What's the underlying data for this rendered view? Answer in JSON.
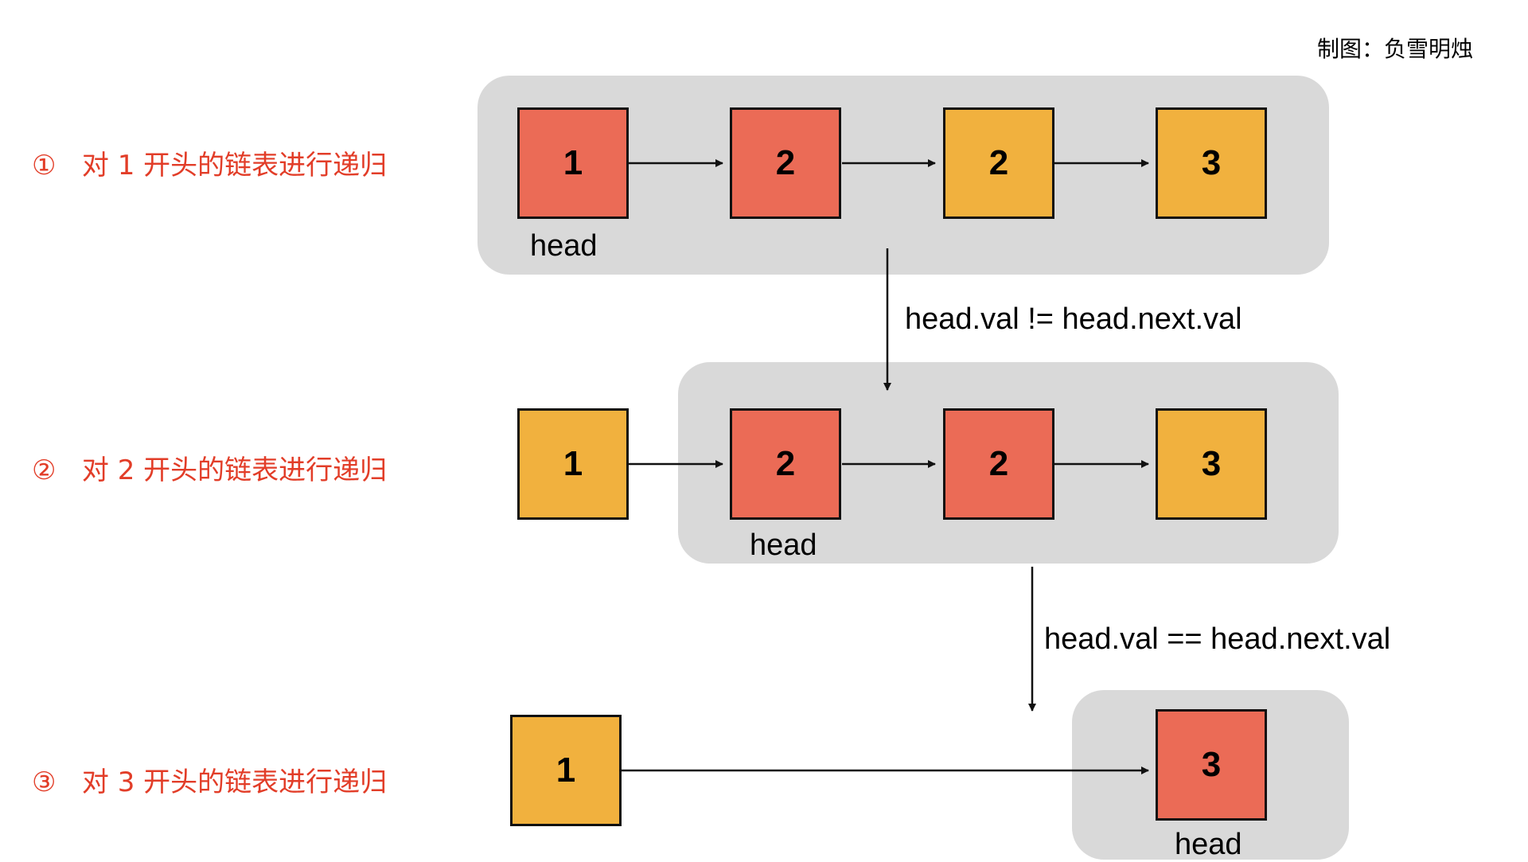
{
  "credit": "制图：负雪明烛",
  "steps": [
    {
      "marker": "①",
      "text": "对 1 开头的链表进行递归"
    },
    {
      "marker": "②",
      "text": "对 2 开头的链表进行递归"
    },
    {
      "marker": "③",
      "text": "对 3 开头的链表进行递归"
    }
  ],
  "rows": [
    {
      "nodes": [
        "1",
        "2",
        "2",
        "3"
      ],
      "head_label": "head"
    },
    {
      "nodes": [
        "1",
        "2",
        "2",
        "3"
      ],
      "head_label": "head"
    },
    {
      "nodes": [
        "1",
        "3"
      ],
      "head_label": "head"
    }
  ],
  "transitions": [
    {
      "condition": "head.val != head.next.val"
    },
    {
      "condition": "head.val == head.next.val"
    }
  ],
  "colors": {
    "red": "#eb6b56",
    "yellow": "#f1b13e",
    "panel": "#d9d9d9",
    "step_text": "#e23d28"
  }
}
